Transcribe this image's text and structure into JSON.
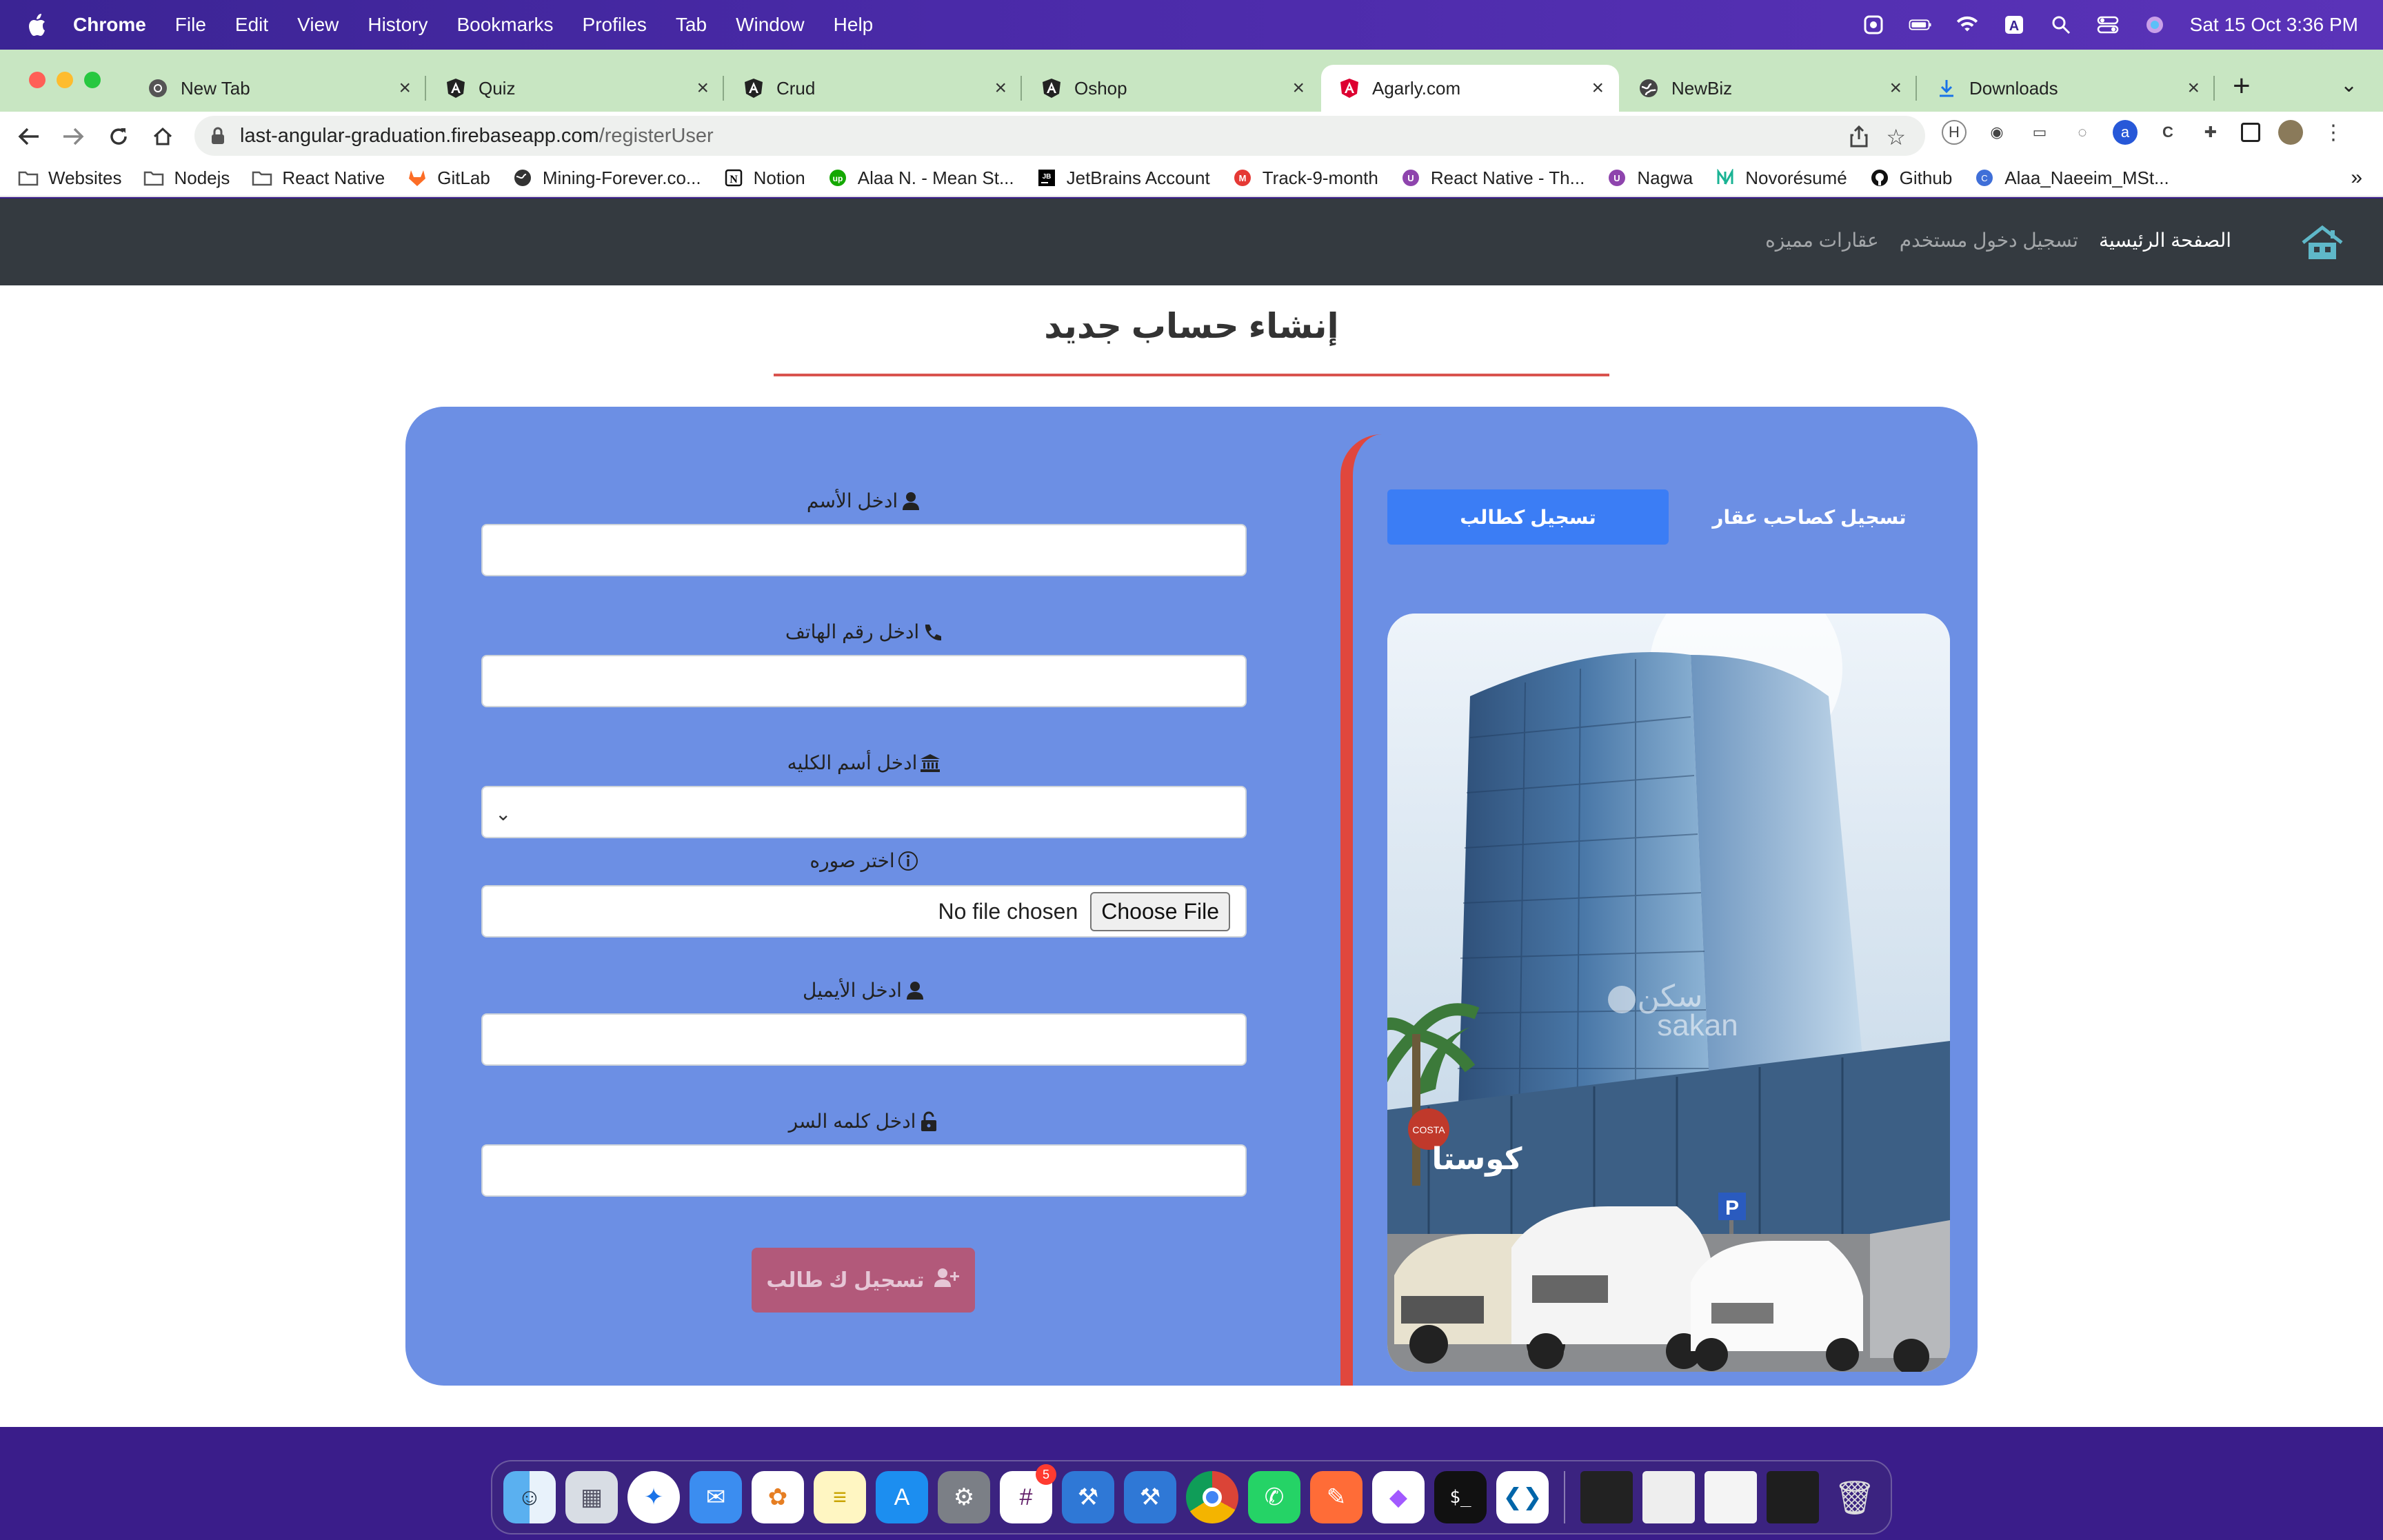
{
  "menubar": {
    "app": "Chrome",
    "items": [
      "File",
      "Edit",
      "View",
      "History",
      "Bookmarks",
      "Profiles",
      "Tab",
      "Window",
      "Help"
    ],
    "clock": "Sat 15 Oct  3:36 PM"
  },
  "tabs": [
    {
      "title": "New Tab",
      "icon": "chrome-icon"
    },
    {
      "title": "Quiz",
      "icon": "angular-icon"
    },
    {
      "title": "Crud",
      "icon": "angular-icon"
    },
    {
      "title": "Oshop",
      "icon": "angular-icon"
    },
    {
      "title": "Agarly.com",
      "icon": "angular-red-icon",
      "active": true
    },
    {
      "title": "NewBiz",
      "icon": "globe-icon"
    },
    {
      "title": "Downloads",
      "icon": "download-icon"
    }
  ],
  "address": {
    "host": "last-angular-graduation.firebaseapp.com",
    "path": "/registerUser"
  },
  "bookmarks": [
    {
      "label": "Websites",
      "icon": "folder-icon"
    },
    {
      "label": "Nodejs",
      "icon": "folder-icon"
    },
    {
      "label": "React Native",
      "icon": "folder-icon"
    },
    {
      "label": "GitLab",
      "icon": "gitlab-icon"
    },
    {
      "label": "Mining-Forever.co...",
      "icon": "globe-icon"
    },
    {
      "label": "Notion",
      "icon": "notion-icon"
    },
    {
      "label": "Alaa N. - Mean St...",
      "icon": "upwork-icon"
    },
    {
      "label": "JetBrains Account",
      "icon": "jetbrains-icon"
    },
    {
      "label": "Track-9-month",
      "icon": "m-icon"
    },
    {
      "label": "React Native - Th...",
      "icon": "udemy-icon"
    },
    {
      "label": "Nagwa",
      "icon": "udemy-icon"
    },
    {
      "label": "Novorésumé",
      "icon": "novoresume-icon"
    },
    {
      "label": "Github",
      "icon": "github-icon"
    },
    {
      "label": "Alaa_Naeeim_MSt...",
      "icon": "circle-icon"
    }
  ],
  "site": {
    "nav": {
      "home": "الصفحة الرئيسية",
      "login": "تسجيل دخول مستخدم",
      "featured": "عقارات مميزه"
    },
    "title": "إنشاء حساب جديد",
    "form": {
      "name_label": "ادخل الأسم",
      "phone_label": "ادخل رقم الهاتف",
      "college_label": "ادخل أسم الكليه",
      "image_label": "اختر صوره",
      "file_button": "Choose File",
      "file_status": "No file chosen",
      "email_label": "ادخل الأيميل",
      "password_label": "ادخل كلمه السر",
      "submit": "تسجيل ك طالب"
    },
    "roles": {
      "student": "تسجيل كطالب",
      "owner": "تسجيل كصاحب عقار"
    },
    "photo": {
      "watermark_ar": "سكن",
      "watermark_en": "sakan",
      "sign": "كوستا",
      "parking": "P"
    }
  },
  "colors": {
    "card": "#6c8fe4",
    "accent_red": "#e0473d",
    "active_tab": "#3b7df5",
    "submit": "#b2597a",
    "nav": "#343a40"
  },
  "dock": {
    "badge": "5"
  }
}
